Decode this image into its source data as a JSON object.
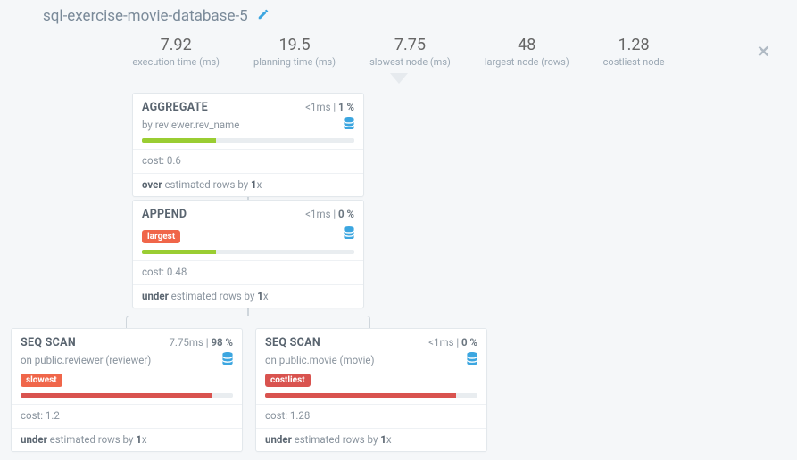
{
  "title": "sql-exercise-movie-database-5",
  "stats": {
    "exec_val": "7.92",
    "exec_lbl": "execution time (ms)",
    "plan_val": "19.5",
    "plan_lbl": "planning time (ms)",
    "slow_val": "7.75",
    "slow_lbl": "slowest node (ms)",
    "large_val": "48",
    "large_lbl": "largest node (rows)",
    "cost_val": "1.28",
    "cost_lbl": "costliest node"
  },
  "nodes": {
    "agg": {
      "name": "AGGREGATE",
      "timing": "<1ms",
      "pct": "1 %",
      "sub_prefix": "by ",
      "sub": "reviewer.rev_name",
      "bar_pct": 35,
      "bar_color": "green",
      "cost": "0.6",
      "est_b1": "over",
      "est_mid": " estimated rows by ",
      "est_b2": "1",
      "est_suffix": "x"
    },
    "append": {
      "name": "APPEND",
      "timing": "<1ms",
      "pct": "0 %",
      "tag": "largest",
      "bar_pct": 35,
      "bar_color": "green",
      "cost": "0.48",
      "est_b1": "under",
      "est_mid": " estimated rows by ",
      "est_b2": "1",
      "est_suffix": "x"
    },
    "seq1": {
      "name": "SEQ SCAN",
      "timing": "7.75ms",
      "pct": "98 %",
      "sub_prefix": "on ",
      "sub": "public.reviewer (reviewer)",
      "tag": "slowest",
      "bar_pct": 90,
      "bar_color": "red",
      "cost": "1.2",
      "est_b1": "under",
      "est_mid": " estimated rows by ",
      "est_b2": "1",
      "est_suffix": "x"
    },
    "seq2": {
      "name": "SEQ SCAN",
      "timing": "<1ms",
      "pct": "0 %",
      "sub_prefix": "on ",
      "sub": "public.movie (movie)",
      "tag": "costliest",
      "bar_pct": 90,
      "bar_color": "red",
      "cost": "1.28",
      "est_b1": "under",
      "est_mid": " estimated rows by ",
      "est_b2": "1",
      "est_suffix": "x"
    }
  },
  "labels": {
    "cost_prefix": "cost: "
  }
}
